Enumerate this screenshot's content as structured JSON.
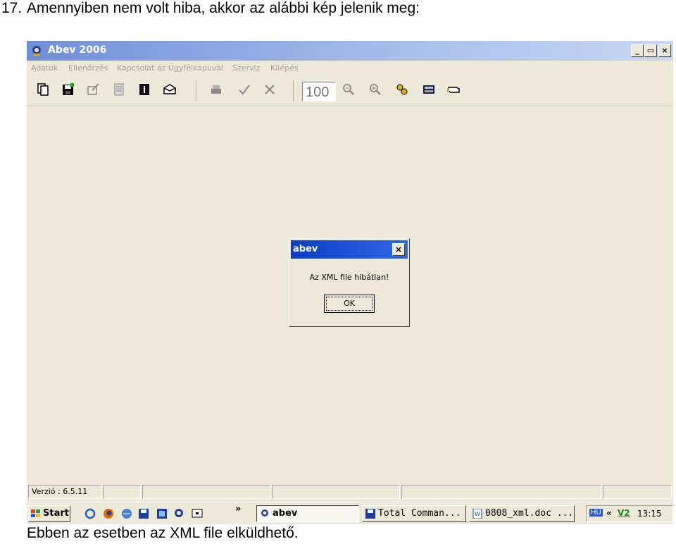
{
  "document": {
    "heading_number": "17.",
    "heading_text": "Amennyiben nem volt hiba, akkor az alábbi kép jelenik meg:",
    "footer_text": "Ebben az esetben az XML file elküldhető."
  },
  "window": {
    "title": "Abev 2006",
    "minimize_label": "_",
    "restore_label": "▭",
    "close_label": "×"
  },
  "menubar": {
    "items": [
      "Adatok",
      "Ellenőrzés",
      "Kapcsolat az Ügyfélkapuval",
      "Szerviz",
      "Kilépés"
    ]
  },
  "toolbar": {
    "zoom_value": "100"
  },
  "dialog": {
    "title": "abev",
    "close_label": "×",
    "message": "Az XML file hibátlan!",
    "ok_label": "OK"
  },
  "statusbar": {
    "version": "Verzió : 6.5.11"
  },
  "taskbar": {
    "start_label": "Start",
    "overflow_label": "»",
    "tasks": [
      "abev",
      "Total Comman...",
      "0808_xml.doc ..."
    ],
    "tray_lang": "HU",
    "tray_chevron": "«",
    "tray_app": "V2",
    "clock": "13:15"
  }
}
